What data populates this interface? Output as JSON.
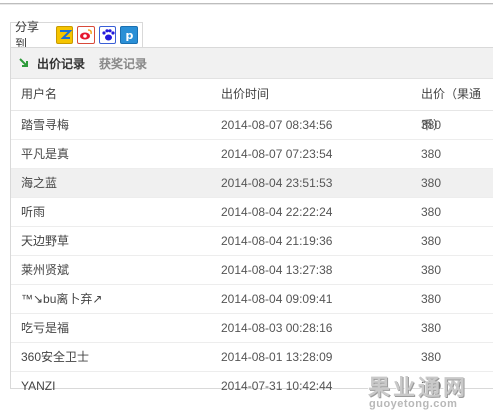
{
  "share": {
    "label": "分享到",
    "icons": [
      "qzone-icon",
      "weibo-icon",
      "baidu-icon",
      "pengyou-icon"
    ]
  },
  "tabs": [
    {
      "label": "出价记录",
      "active": true
    },
    {
      "label": "获奖记录",
      "active": false
    }
  ],
  "table": {
    "headers": [
      "用户名",
      "出价时间",
      "出价（果通币）"
    ],
    "rows": [
      {
        "user": "踏雪寻梅",
        "time": "2014-08-07 08:34:56",
        "bid": "380"
      },
      {
        "user": "平凡是真",
        "time": "2014-08-07 07:23:54",
        "bid": "380"
      },
      {
        "user": "海之蓝",
        "time": "2014-08-04 23:51:53",
        "bid": "380"
      },
      {
        "user": "听雨",
        "time": "2014-08-04 22:22:24",
        "bid": "380"
      },
      {
        "user": "天边野草",
        "time": "2014-08-04 21:19:36",
        "bid": "380"
      },
      {
        "user": "莱州贤斌",
        "time": "2014-08-04 13:27:38",
        "bid": "380"
      },
      {
        "user": "™↘bu离卜弃↗",
        "time": "2014-08-04 09:09:41",
        "bid": "380"
      },
      {
        "user": "吃亏是福",
        "time": "2014-08-03 00:28:16",
        "bid": "380"
      },
      {
        "user": "360安全卫士",
        "time": "2014-08-01 13:28:09",
        "bid": "380"
      },
      {
        "user": "YANZI",
        "time": "2014-07-31 10:42:44",
        "bid": "380"
      }
    ]
  },
  "watermark": {
    "title": "果业通网",
    "url": "guoyetong.com"
  },
  "colors": {
    "tab_bg": "#f1f1f1",
    "highlight_row": "#f0f0f0",
    "arrow": "#2e9b3a"
  }
}
